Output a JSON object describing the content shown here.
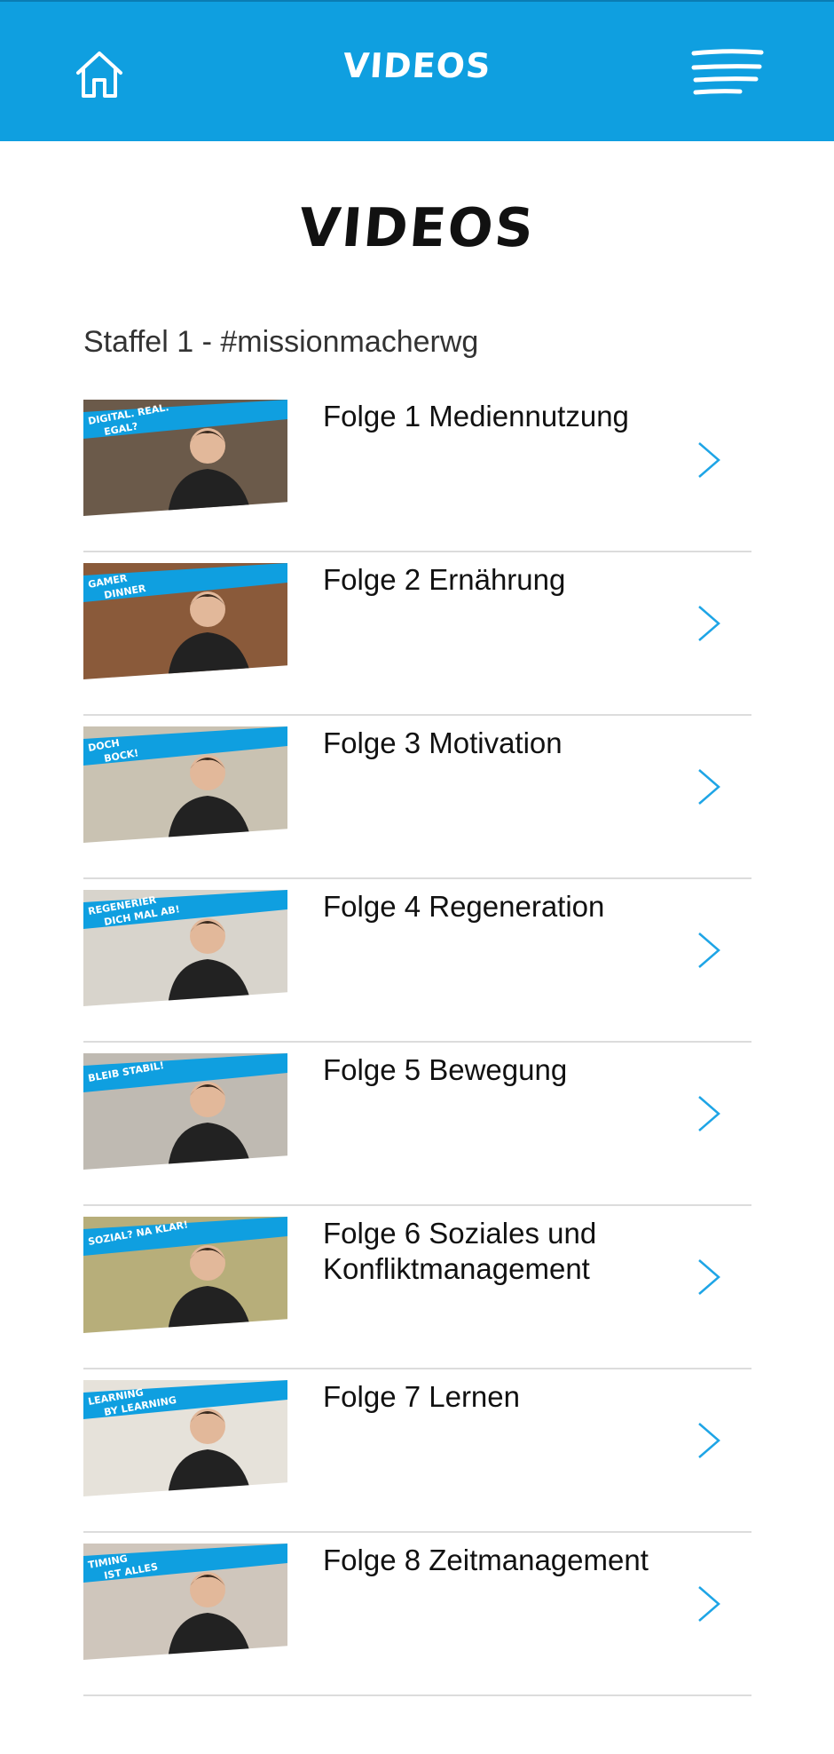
{
  "header": {
    "title": "VIDEOS",
    "home_icon": "home-icon",
    "menu_icon": "menu-icon",
    "accent_color": "#0f9fe0"
  },
  "page": {
    "title": "VIDEOS"
  },
  "section": {
    "heading": "Staffel 1 - #missionmacherwg"
  },
  "episodes": [
    {
      "title": "Folge 1 Mediennutzung",
      "thumb_caption": [
        "DIGITAL. REAL.",
        "EGAL?"
      ],
      "thumb_bg": "#6b5a4a"
    },
    {
      "title": "Folge 2 Ernährung",
      "thumb_caption": [
        "GAMER",
        "DINNER"
      ],
      "thumb_bg": "#8a5a3a"
    },
    {
      "title": "Folge 3 Motivation",
      "thumb_caption": [
        "DOCH",
        "BOCK!"
      ],
      "thumb_bg": "#c9c2b2"
    },
    {
      "title": "Folge 4 Regeneration",
      "thumb_caption": [
        "REGENERIER",
        "DICH MAL AB!"
      ],
      "thumb_bg": "#d8d4cc"
    },
    {
      "title": "Folge 5 Bewegung",
      "thumb_caption": [
        "BLEIB STABIL!"
      ],
      "thumb_bg": "#bfbab2"
    },
    {
      "title": "Folge 6 Soziales und Konfliktmanagement",
      "thumb_caption": [
        "SOZIAL? NA KLAR!"
      ],
      "thumb_bg": "#b7ae7a"
    },
    {
      "title": "Folge 7 Lernen",
      "thumb_caption": [
        "LEARNING",
        "BY LEARNING"
      ],
      "thumb_bg": "#e6e2da"
    },
    {
      "title": "Folge 8 Zeitmanagement",
      "thumb_caption": [
        "TIMING",
        "IST ALLES"
      ],
      "thumb_bg": "#cfc6bc"
    }
  ],
  "icons": {
    "row_arrow": "chevron-right-icon"
  },
  "colors": {
    "accent": "#0f9fe0",
    "chevron": "#1ea5e6",
    "divider": "#dcdcdc"
  }
}
